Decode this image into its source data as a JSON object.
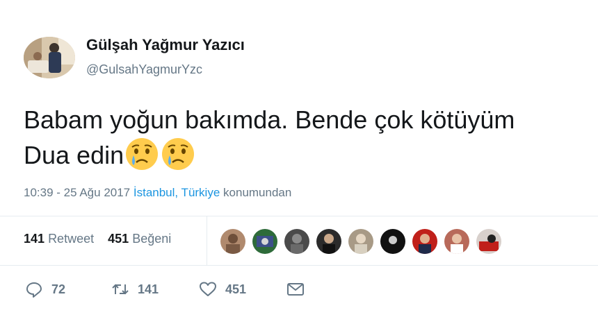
{
  "user": {
    "name": "Gülşah Yağmur Yazıcı",
    "handle": "@GulsahYagmurYzc"
  },
  "tweet": {
    "line1": "Babam yoğun bakımda. Bende çok kötüyüm",
    "line2": "Dua edin",
    "emoji": [
      "crying-face",
      "crying-face"
    ]
  },
  "meta": {
    "time": "10:39 - 25 Ağu 2017",
    "place": "İstanbul, Türkiye",
    "suffix": "konumundan"
  },
  "stats": {
    "retweet_count": "141",
    "retweet_label": "Retweet",
    "like_count": "451",
    "like_label": "Beğeni"
  },
  "likers": [
    {
      "name": "liker-1",
      "color": "#b08a6e"
    },
    {
      "name": "liker-2",
      "color": "#2e6b3a"
    },
    {
      "name": "liker-3",
      "color": "#4a4a4a"
    },
    {
      "name": "liker-4",
      "color": "#2b2b2b"
    },
    {
      "name": "liker-5",
      "color": "#a89a86"
    },
    {
      "name": "liker-6",
      "color": "#111111"
    },
    {
      "name": "liker-7",
      "color": "#c0201a"
    },
    {
      "name": "liker-8",
      "color": "#b86a5a"
    },
    {
      "name": "liker-9",
      "color": "#d8d0cc"
    }
  ],
  "actions": {
    "reply_count": "72",
    "retweet_count": "141",
    "like_count": "451"
  },
  "icons": {
    "reply": "reply-icon",
    "retweet": "retweet-icon",
    "like": "heart-icon",
    "message": "envelope-icon"
  },
  "colors": {
    "link": "#1b95e0",
    "muted": "#657786",
    "text": "#14171a"
  }
}
